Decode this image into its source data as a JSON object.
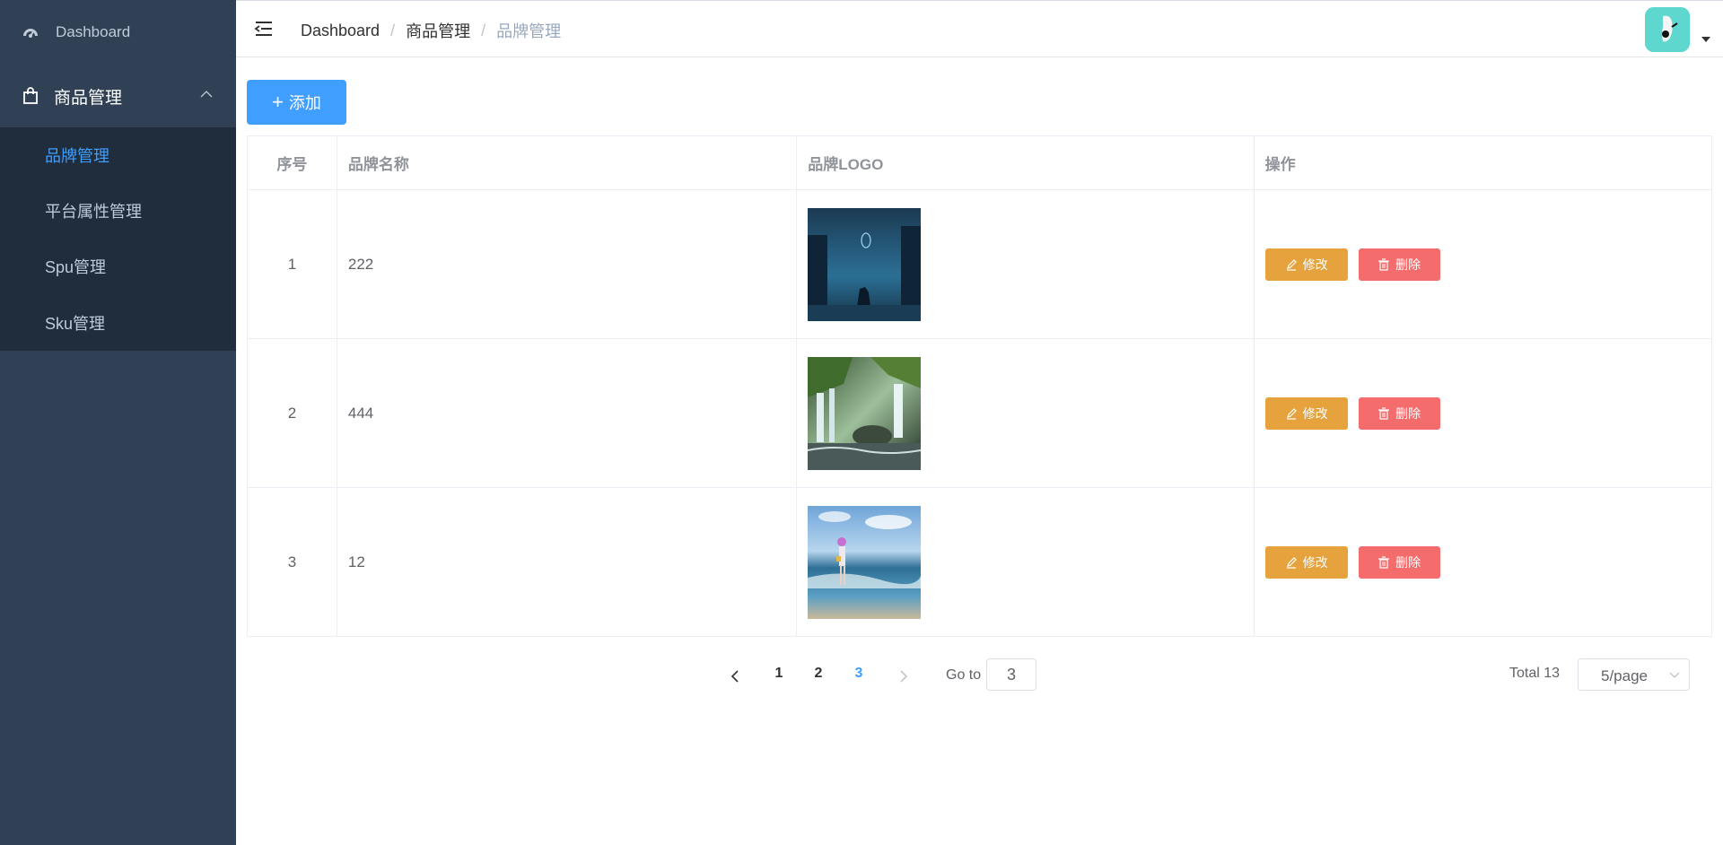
{
  "sidebar": {
    "dashboard": "Dashboard",
    "goods": "商品管理",
    "items": [
      {
        "label": "品牌管理"
      },
      {
        "label": "平台属性管理"
      },
      {
        "label": "Spu管理"
      },
      {
        "label": "Sku管理"
      }
    ],
    "colors": {
      "bg": "#304156",
      "sub_bg": "#1f2d3d",
      "active": "#409eff"
    }
  },
  "header": {
    "breadcrumb": [
      "Dashboard",
      "商品管理",
      "品牌管理"
    ],
    "separator": "/"
  },
  "toolbar": {
    "add_label": "添加"
  },
  "table": {
    "columns": [
      "序号",
      "品牌名称",
      "品牌LOGO",
      "操作"
    ],
    "rows": [
      {
        "index": "1",
        "name": "222",
        "logo_icon": "night-forest-deer-image"
      },
      {
        "index": "2",
        "name": "444",
        "logo_icon": "waterfall-image"
      },
      {
        "index": "3",
        "name": "12",
        "logo_icon": "girl-on-beach-image"
      }
    ],
    "edit_label": "修改",
    "delete_label": "删除"
  },
  "pagination": {
    "pages": [
      "1",
      "2",
      "3"
    ],
    "current": "3",
    "goto_label": "Go to",
    "goto_value": "3",
    "total_label": "Total 13",
    "page_size": "5/page"
  }
}
